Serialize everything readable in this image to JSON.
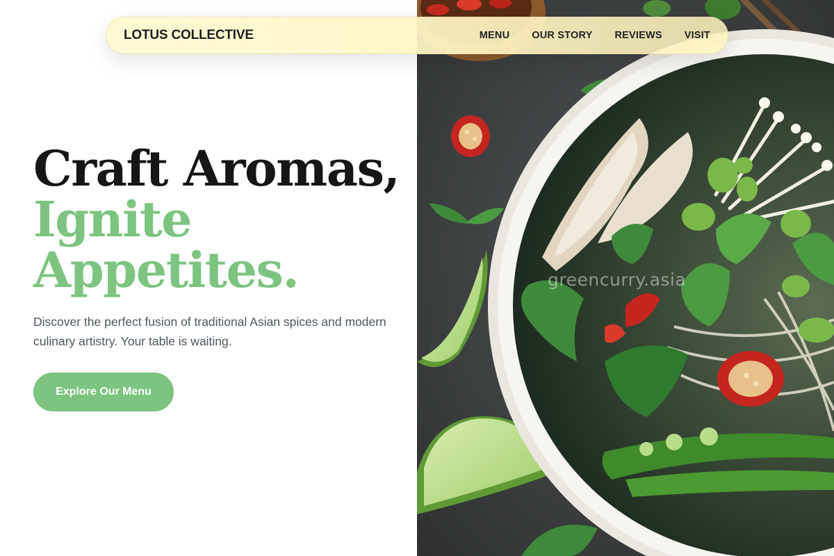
{
  "nav": {
    "brand": "LOTUS COLLECTIVE",
    "links": [
      "MENU",
      "OUR STORY",
      "REVIEWS",
      "VISIT"
    ]
  },
  "hero": {
    "title_line1": "Craft Aromas,",
    "title_line2": "Ignite",
    "title_line3": "Appetites.",
    "description": "Discover the perfect fusion of traditional Asian spices and modern culinary artistry. Your table is waiting.",
    "cta_label": "Explore Our Menu"
  },
  "photo": {
    "watermark": "greencurry.asia"
  },
  "colors": {
    "accent_green": "#7cc47f",
    "nav_background": "#fff7cc",
    "heading_dark": "#161616",
    "body_text": "#4c5660"
  }
}
